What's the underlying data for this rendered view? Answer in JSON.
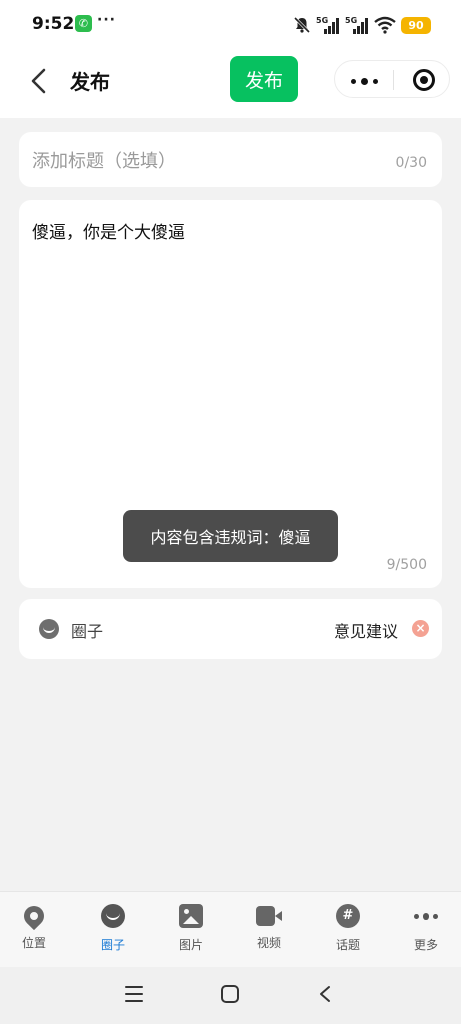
{
  "status_bar": {
    "time": "9:52",
    "call_badge": "✆",
    "more_indicator": "···",
    "signal_1_label": "5G",
    "signal_2_label": "5G",
    "battery": "90"
  },
  "header": {
    "title": "发布",
    "publish_label": "发布"
  },
  "title_field": {
    "placeholder": "添加标题（选填）",
    "count": "0/30"
  },
  "content_field": {
    "text": "傻逼，你是个大傻逼",
    "count": "9/500"
  },
  "toast": {
    "message": "内容包含违规词：傻逼"
  },
  "circle_row": {
    "label": "圈子",
    "feedback_label": "意见建议"
  },
  "toolbar": {
    "items": [
      {
        "label": "位置",
        "icon": "location-icon",
        "active": false
      },
      {
        "label": "圈子",
        "icon": "circle-icon",
        "active": true
      },
      {
        "label": "图片",
        "icon": "image-icon",
        "active": false
      },
      {
        "label": "视频",
        "icon": "video-icon",
        "active": false
      },
      {
        "label": "话题",
        "icon": "topic-icon",
        "active": false
      },
      {
        "label": "更多",
        "icon": "more-icon",
        "active": false
      }
    ]
  },
  "colors": {
    "publish_button": "#07c160",
    "active_tab": "#1a7ad4",
    "battery": "#f5b400",
    "toast_background": "#4c4c4c"
  }
}
